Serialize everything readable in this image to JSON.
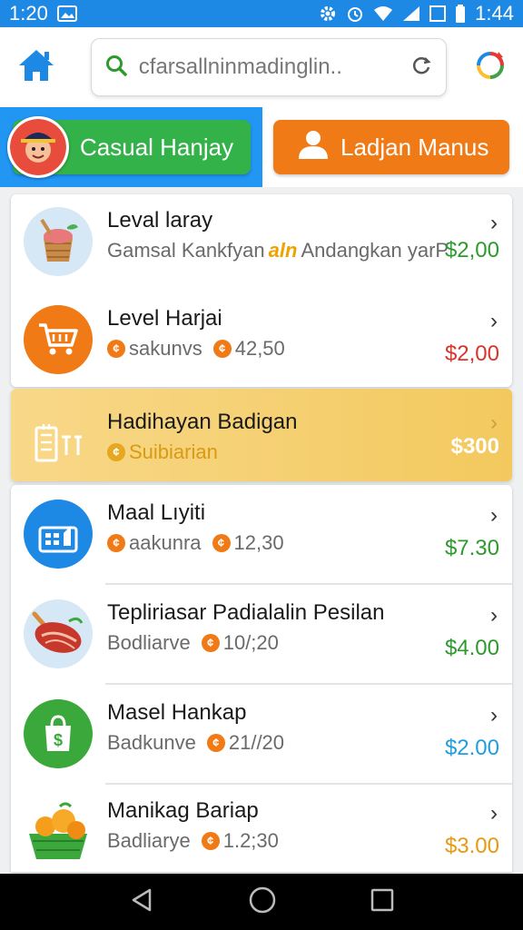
{
  "status_bar": {
    "time_left": "1:20",
    "time_right": "1:44"
  },
  "search": {
    "query": "cfarsallninmadinglin.."
  },
  "tabs": {
    "left_label": "Casual Hanjay",
    "right_label": "Ladjan Manus"
  },
  "items": [
    {
      "title": "Leval laray",
      "sub_a": "Gamsal Kankfyan",
      "sub_highlight": "aln",
      "sub_b": "Andangkan yarP",
      "price": "$2,00",
      "price_color": "#2e9a2e",
      "icon": "basket-icon",
      "icon_bg": "#d6e8f5"
    },
    {
      "title": "Level Harjai",
      "sub_a": "sakunvs",
      "sub_b": "42,50",
      "price": "$2,00",
      "price_color": "#d9342b",
      "icon": "cart-icon",
      "icon_bg": "#f07a16"
    },
    {
      "title": "Hadihayan Badigan",
      "sub_a": "Suibiarian",
      "price": "$300",
      "price_color": "#ffffff",
      "icon": "receipt-icon",
      "highlighted": true
    },
    {
      "title": "Maal Lıyiti",
      "sub_a": "aakunra",
      "sub_b": "12,30",
      "price": "$7.30",
      "price_color": "#2e9a2e",
      "icon": "store-icon",
      "icon_bg": "#1e88e5"
    },
    {
      "title": "Tepliriasar Padialalin Pesilan",
      "sub_a": "Bodliarve",
      "sub_b": "10/;20",
      "price": "$4.00",
      "price_color": "#2e9a2e",
      "icon": "meat-icon",
      "icon_bg": "#d6e8f5"
    },
    {
      "title": "Masel Hankap",
      "sub_a": "Badkunve",
      "sub_b": "21//20",
      "price": "$2.00",
      "price_color": "#1e9ee0",
      "icon": "shopping-bag-icon",
      "icon_bg": "#3aa83a"
    },
    {
      "title": "Manikag Bariap",
      "sub_a": "Badliarye",
      "sub_b": "1.2;30",
      "price": "$3.00",
      "price_color": "#e69a12",
      "icon": "fruit-basket-icon",
      "icon_bg": "#fff"
    }
  ]
}
